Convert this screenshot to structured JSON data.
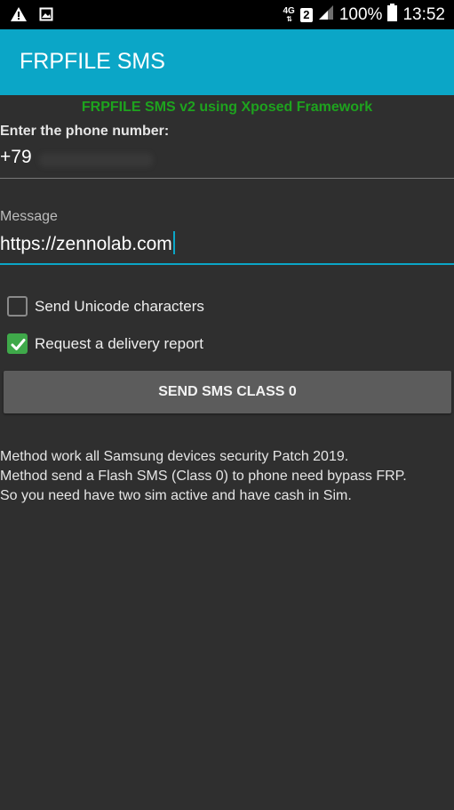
{
  "status_bar": {
    "network_type": "4G",
    "sim_number": "2",
    "battery": "100%",
    "time": "13:52",
    "icons": [
      "warning-icon",
      "image-icon",
      "signal-icon",
      "battery-icon"
    ]
  },
  "app_bar": {
    "title": "FRPFILE SMS",
    "color": "#0ba6c7"
  },
  "subtitle": "FRPFILE SMS v2 using Xposed Framework",
  "phone": {
    "label": "Enter the phone number:",
    "value": "+79"
  },
  "message": {
    "label": "Message",
    "value": "https://zennolab.com"
  },
  "options": {
    "unicode": {
      "label": "Send Unicode characters",
      "checked": false
    },
    "delivery_report": {
      "label": "Request a delivery report",
      "checked": true
    }
  },
  "send_button": {
    "label": "SEND SMS CLASS 0"
  },
  "info_lines": [
    "Method work all Samsung devices security Patch 2019.",
    "Method send a Flash SMS (Class 0) to phone need bypass FRP.",
    "So you need have two sim active and have cash in Sim."
  ]
}
